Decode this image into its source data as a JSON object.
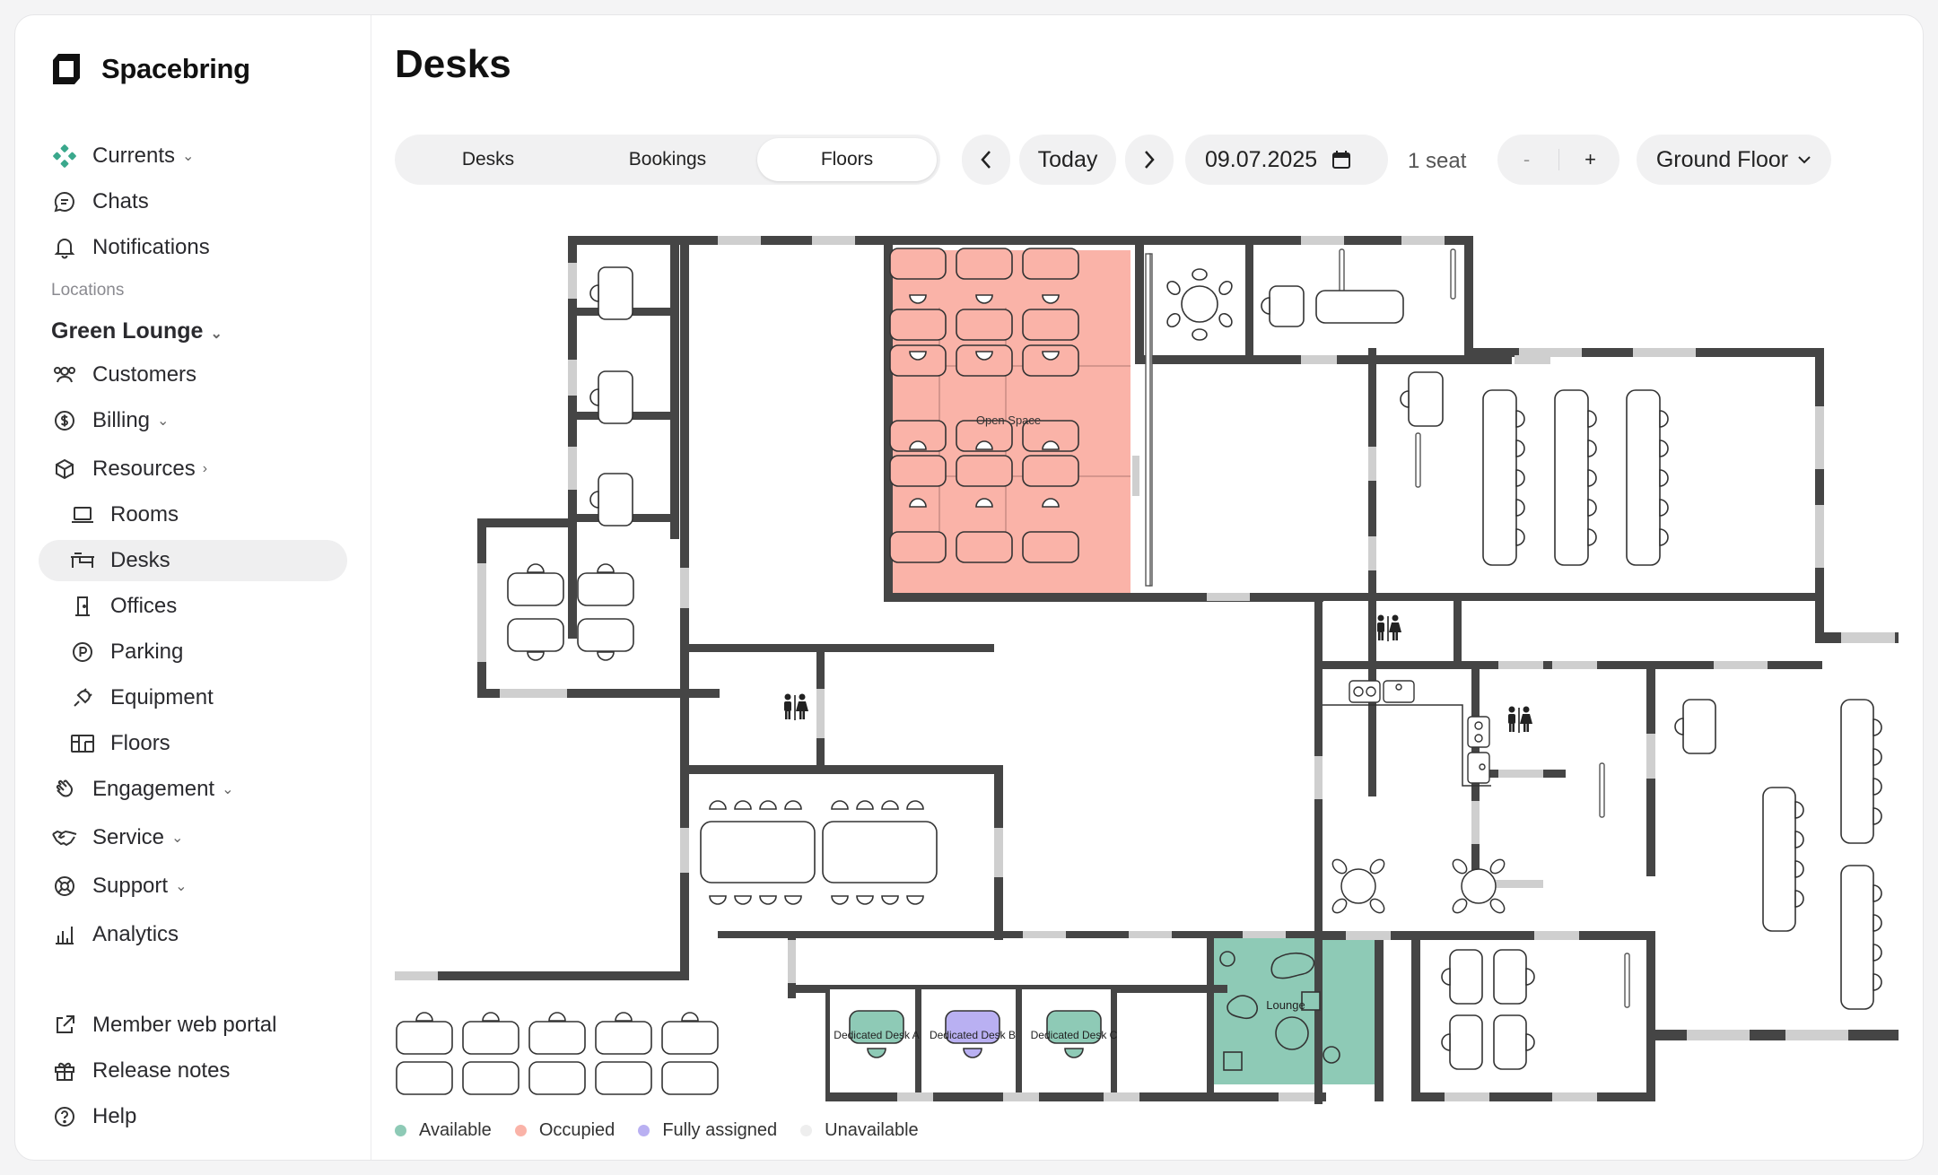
{
  "app": {
    "name": "Spacebring"
  },
  "sidebar": {
    "currents": "Currents",
    "chats": "Chats",
    "notifications": "Notifications",
    "locations_label": "Locations",
    "location": "Green Lounge",
    "customers": "Customers",
    "billing": "Billing",
    "resources": "Resources",
    "rooms": "Rooms",
    "desks": "Desks",
    "offices": "Offices",
    "parking": "Parking",
    "equipment": "Equipment",
    "floors": "Floors",
    "engagement": "Engagement",
    "service": "Service",
    "support": "Support",
    "analytics": "Analytics",
    "member_portal": "Member web portal",
    "release_notes": "Release notes",
    "help": "Help"
  },
  "page": {
    "title": "Desks"
  },
  "tabs": [
    "Desks",
    "Bookings",
    "Floors"
  ],
  "toolbar": {
    "prev_icon": "chevron-left-icon",
    "today": "Today",
    "next_icon": "chevron-right-icon",
    "date": "09.07.2025",
    "seat_label": "1 seat",
    "minus": "-",
    "plus": "+",
    "floor": "Ground Floor"
  },
  "floorplan": {
    "open_space": "Open Space",
    "desk_a": "Dedicated Desk A",
    "desk_b": "Dedicated Desk B",
    "desk_c": "Dedicated Desk C",
    "lounge": "Lounge",
    "colors": {
      "occupied": "#fab3a8",
      "available": "#8ecab6",
      "assigned": "#b9b0f2",
      "wall": "#454545",
      "window": "#cfcfcf"
    }
  },
  "legend": [
    {
      "label": "Available",
      "color": "#8ecab6"
    },
    {
      "label": "Occupied",
      "color": "#fab3a8"
    },
    {
      "label": "Fully assigned",
      "color": "#b9b0f2"
    },
    {
      "label": "Unavailable",
      "color": "#eeeeee"
    }
  ]
}
